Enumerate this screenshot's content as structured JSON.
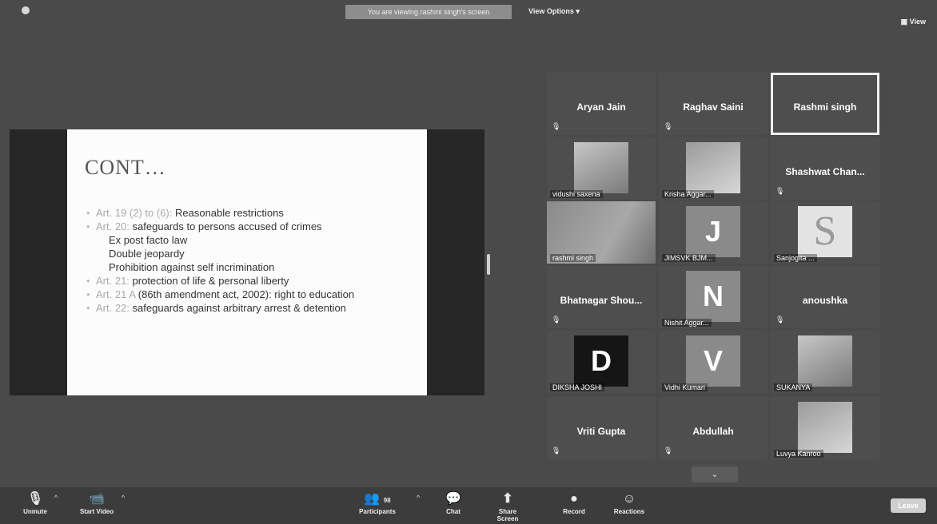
{
  "topbar": {
    "banner": "You are viewing rashmi singh's screen",
    "view_options": "View Options ▾",
    "view": "▦ View"
  },
  "slide": {
    "title": "CONT…",
    "lines": [
      {
        "art": "Art. 19 (2) to (6):",
        "text": " Reasonable restrictions"
      },
      {
        "art": "Art. 20:",
        "text": " safeguards to persons accused of crimes"
      },
      {
        "art": "",
        "text": "Ex post facto law"
      },
      {
        "art": "",
        "text": "Double jeopardy"
      },
      {
        "art": "",
        "text": "Prohibition against self incrimination"
      },
      {
        "art": "Art. 21:",
        "text": " protection of life & personal liberty"
      },
      {
        "art": "Art. 21 A",
        "text": " (86th amendment act, 2002): right to education"
      },
      {
        "art": "Art. 22:",
        "text": " safeguards against arbitrary arrest & detention"
      }
    ]
  },
  "participants": [
    {
      "name": "Aryan Jain",
      "label": "",
      "type": "name"
    },
    {
      "name": "Raghav Saini",
      "label": "",
      "type": "name"
    },
    {
      "name": "Rashmi singh",
      "label": "",
      "type": "name",
      "active": true
    },
    {
      "name": "",
      "label": "vidushi saxena",
      "type": "photo"
    },
    {
      "name": "",
      "label": "Krisha Aggar...",
      "type": "photo2"
    },
    {
      "name": "Shashwat Chan...",
      "label": "",
      "type": "name"
    },
    {
      "name": "",
      "label": "rashmi singh",
      "type": "video"
    },
    {
      "name": "J",
      "label": "JIMSVK BJM...",
      "type": "letter"
    },
    {
      "name": "S",
      "label": "Sanjogita ...",
      "type": "letter-s"
    },
    {
      "name": "Bhatnagar Shou...",
      "label": "",
      "type": "name"
    },
    {
      "name": "N",
      "label": "Nishit Aggar...",
      "type": "letter"
    },
    {
      "name": "anoushka",
      "label": "",
      "type": "name"
    },
    {
      "name": "D",
      "label": "DIKSHA JOSHI",
      "type": "letter-dark"
    },
    {
      "name": "V",
      "label": "Vidhi Kumari",
      "type": "letter"
    },
    {
      "name": "",
      "label": "SUKANYA",
      "type": "photo"
    },
    {
      "name": "Vriti Gupta",
      "label": "",
      "type": "name"
    },
    {
      "name": "Abdullah",
      "label": "",
      "type": "name"
    },
    {
      "name": "",
      "label": "Luvya Kanroo",
      "type": "photo2"
    }
  ],
  "toolbar": {
    "unmute": "Unmute",
    "start_video": "Start Video",
    "participants": "Participants",
    "participants_count": "98",
    "chat": "Chat",
    "share_screen": "Share Screen",
    "record": "Record",
    "reactions": "Reactions",
    "leave": "Leave"
  }
}
